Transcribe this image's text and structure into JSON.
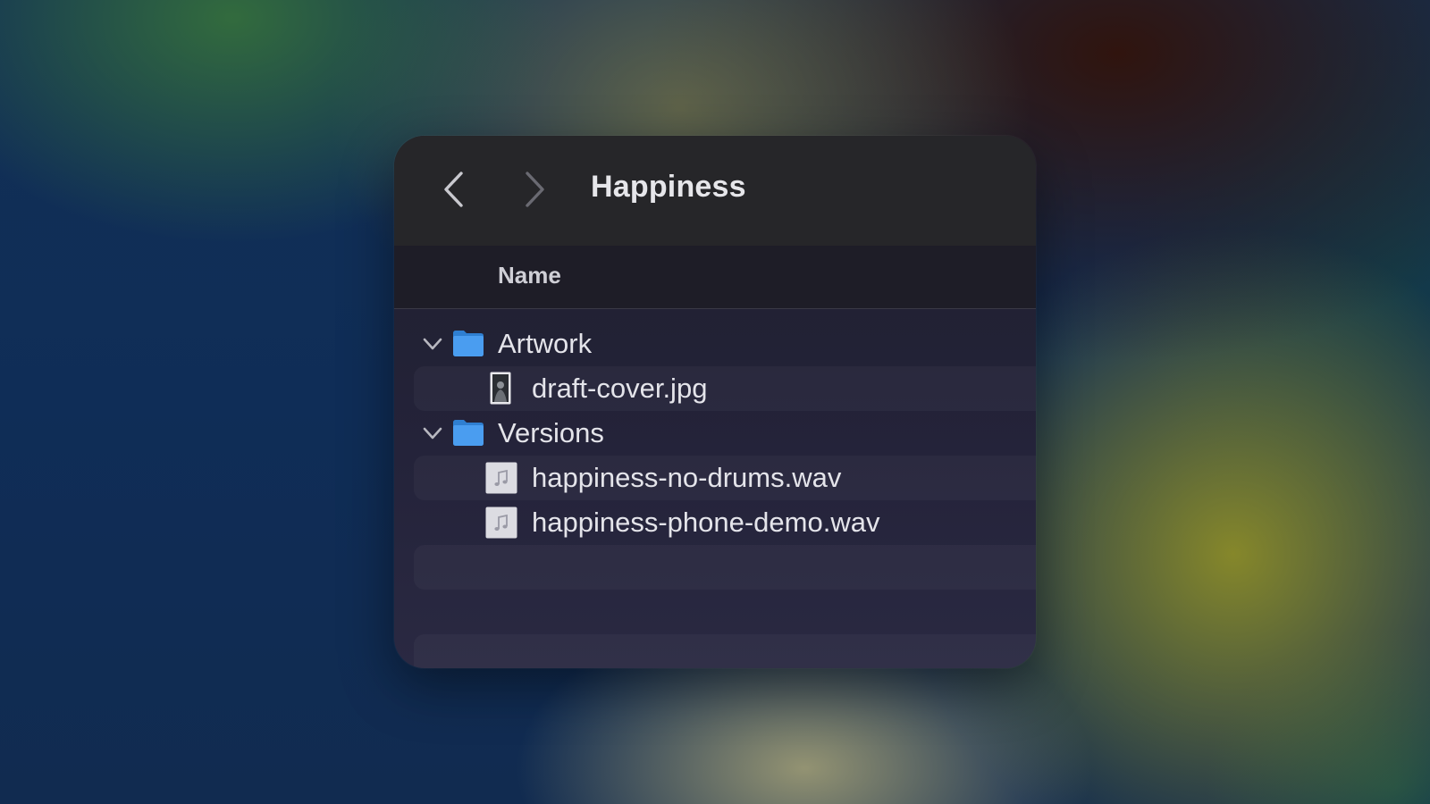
{
  "window": {
    "title": "Happiness"
  },
  "toolbar": {
    "back_icon": "chevron-left-icon",
    "forward_icon": "chevron-right-icon"
  },
  "list": {
    "column_header": "Name",
    "items": [
      {
        "name": "Artwork",
        "type": "folder",
        "expanded": true,
        "icon": "folder-icon"
      },
      {
        "name": "draft-cover.jpg",
        "type": "image",
        "icon": "image-file-icon"
      },
      {
        "name": "Versions",
        "type": "folder",
        "expanded": true,
        "icon": "folder-icon"
      },
      {
        "name": "happiness-no-drums.wav",
        "type": "audio",
        "icon": "audio-file-icon"
      },
      {
        "name": "happiness-phone-demo.wav",
        "type": "audio",
        "icon": "audio-file-icon"
      }
    ]
  },
  "colors": {
    "folder": "#3d8fe0",
    "window_bg": "#24233a",
    "text": "#e4e4ea"
  }
}
